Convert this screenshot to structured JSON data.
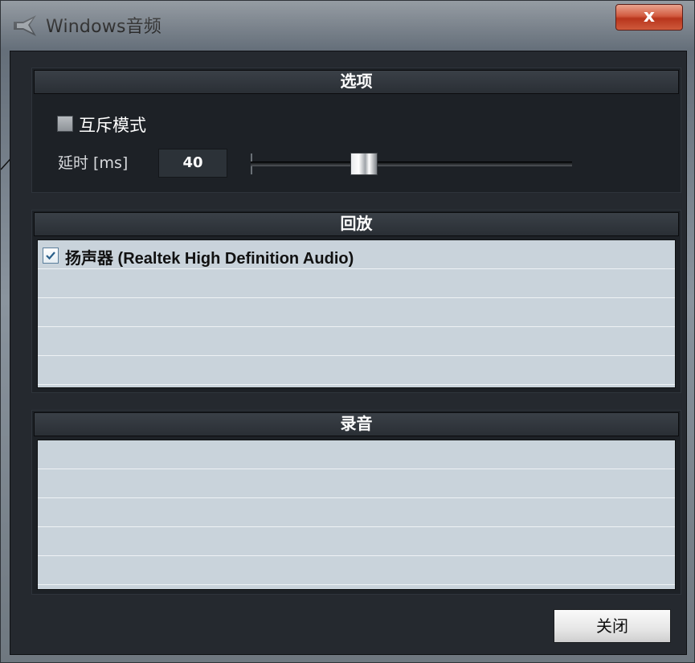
{
  "window": {
    "title": "Windows音频",
    "close_glyph": "x"
  },
  "options": {
    "header": "选项",
    "exclusive_mode_label": "互斥模式",
    "exclusive_mode_checked": false,
    "latency_label": "延时 [ms]",
    "latency_value": "40",
    "latency_slider_fraction": 0.34
  },
  "playback": {
    "header": "回放",
    "devices": [
      {
        "label": "扬声器 (Realtek High Definition Audio)",
        "checked": true
      }
    ]
  },
  "recording": {
    "header": "录音",
    "devices": []
  },
  "footer": {
    "close_label": "关闭"
  },
  "icons": [
    "app-icon",
    "close-icon",
    "checkbox-check-icon"
  ]
}
